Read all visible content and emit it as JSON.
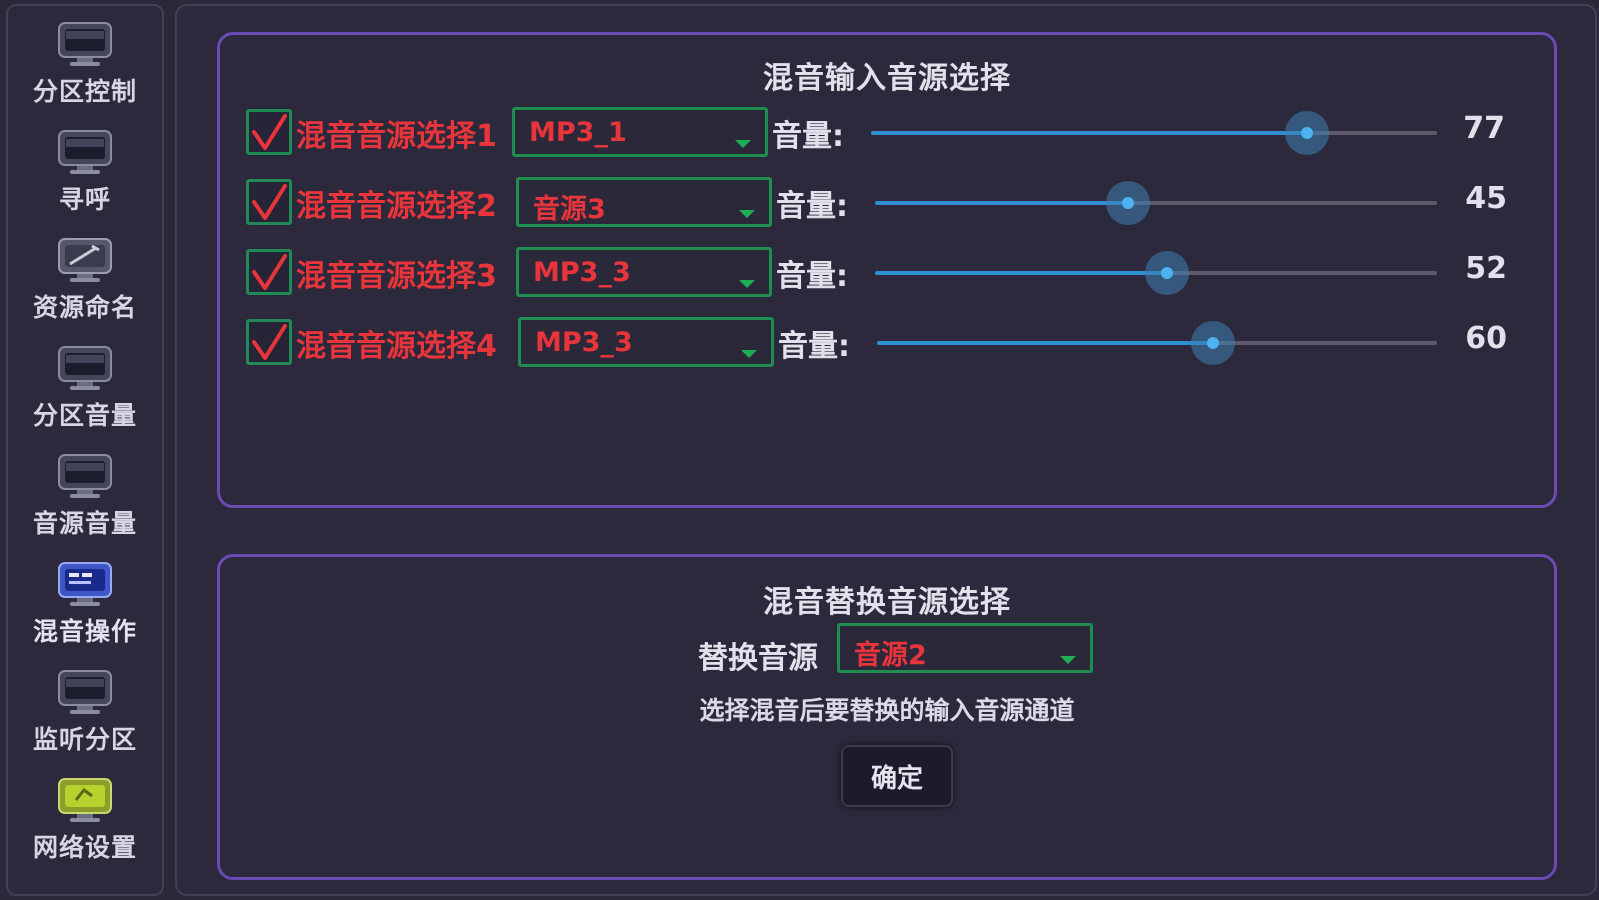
{
  "sidebar": {
    "items": [
      {
        "label": "分区控制",
        "icon": "monitor-icon",
        "active": false
      },
      {
        "label": "寻呼",
        "icon": "monitor-icon",
        "active": false
      },
      {
        "label": "资源命名",
        "icon": "rename-monitor-icon",
        "active": false
      },
      {
        "label": "分区音量",
        "icon": "monitor-icon",
        "active": false
      },
      {
        "label": "音源音量",
        "icon": "monitor-icon",
        "active": false
      },
      {
        "label": "混音操作",
        "icon": "mixer-monitor-icon",
        "active": true
      },
      {
        "label": "监听分区",
        "icon": "monitor-icon",
        "active": false
      },
      {
        "label": "网络设置",
        "icon": "network-monitor-icon",
        "active": false
      }
    ]
  },
  "mix_input": {
    "title": "混音输入音源选择",
    "volume_label": "音量:",
    "rows": [
      {
        "label": "混音音源选择1",
        "checked": true,
        "source": "MP3_1",
        "volume": 77,
        "volume_text": "77"
      },
      {
        "label": "混音音源选择2",
        "checked": true,
        "source": "音源3",
        "volume": 45,
        "volume_text": "45"
      },
      {
        "label": "混音音源选择3",
        "checked": true,
        "source": "MP3_3",
        "volume": 52,
        "volume_text": "52"
      },
      {
        "label": "混音音源选择4",
        "checked": true,
        "source": "MP3_3",
        "volume": 60,
        "volume_text": "60"
      }
    ]
  },
  "mix_replace": {
    "title": "混音替换音源选择",
    "label": "替换音源",
    "source": "音源2",
    "hint": "选择混音后要替换的输入音源通道",
    "confirm_label": "确定"
  },
  "colors": {
    "label_red": "#e8343b",
    "border_green": "#1e8e4e",
    "slider_blue": "#2f8fd0",
    "group_border_purple": "#6b4bb3"
  }
}
